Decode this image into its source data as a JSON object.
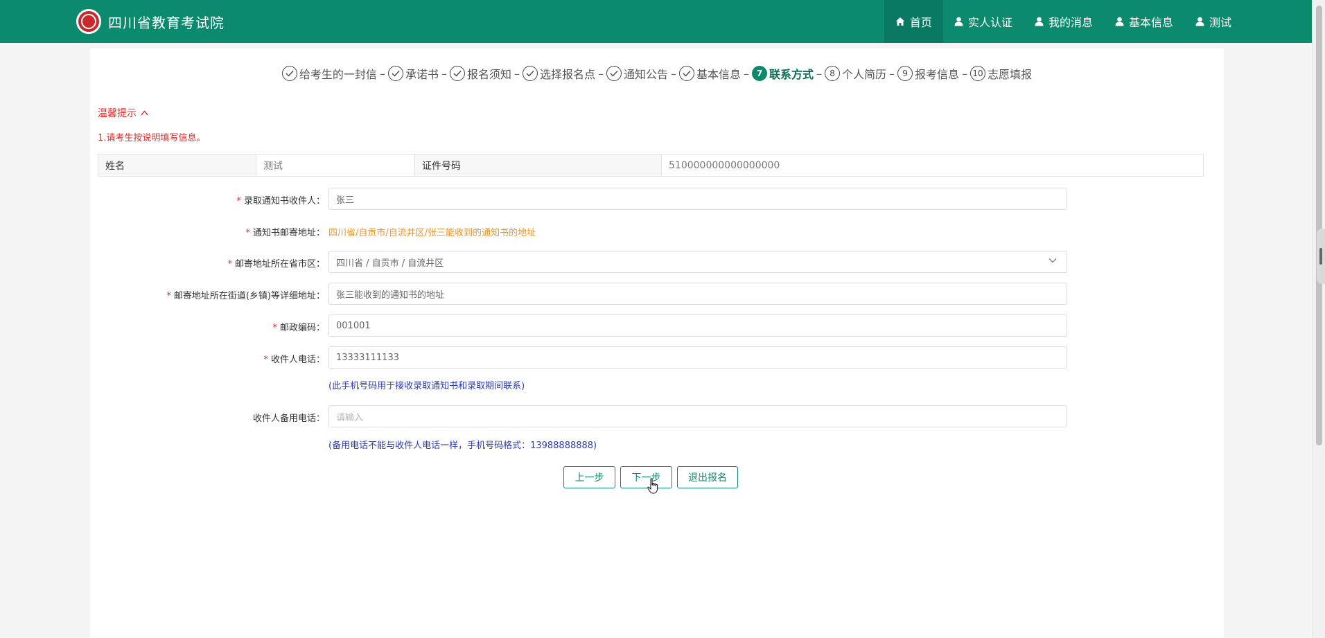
{
  "header": {
    "site_name": "四川省教育考试院",
    "nav": [
      {
        "label": "首页",
        "icon": "home-icon",
        "active": true
      },
      {
        "label": "实人认证",
        "icon": "user-icon"
      },
      {
        "label": "我的消息",
        "icon": "user-icon"
      },
      {
        "label": "基本信息",
        "icon": "user-icon"
      },
      {
        "label": "测试",
        "icon": "user-icon"
      }
    ]
  },
  "steps": [
    {
      "label": "给考生的一封信",
      "status": "done"
    },
    {
      "label": "承诺书",
      "status": "done"
    },
    {
      "label": "报名须知",
      "status": "done"
    },
    {
      "label": "选择报名点",
      "status": "done"
    },
    {
      "label": "通知公告",
      "status": "done"
    },
    {
      "label": "基本信息",
      "status": "done"
    },
    {
      "label": "联系方式",
      "number": "7",
      "status": "active"
    },
    {
      "label": "个人简历",
      "number": "8",
      "status": "todo"
    },
    {
      "label": "报考信息",
      "number": "9",
      "status": "todo"
    },
    {
      "label": "志愿填报",
      "number": "10",
      "status": "todo"
    }
  ],
  "step_separator": "–",
  "tips": {
    "title": "温馨提示",
    "text": "1.请考生按说明填写信息。"
  },
  "info": {
    "name_label": "姓名",
    "name_value": "测试",
    "id_label": "证件号码",
    "id_value": "510000000000000000"
  },
  "form": {
    "recipient": {
      "label": "录取通知书收件人：",
      "value": "张三"
    },
    "mail_address": {
      "label": "通知书邮寄地址：",
      "value": "四川省/自贡市/自流井区/张三能收到的通知书的地址"
    },
    "region": {
      "label": "邮寄地址所在省市区：",
      "value": "四川省 / 自贡市 / 自流井区"
    },
    "detail_address": {
      "label": "邮寄地址所在街道(乡镇)等详细地址：",
      "value": "张三能收到的通知书的地址"
    },
    "postcode": {
      "label": "邮政编码：",
      "value": "001001"
    },
    "phone": {
      "label": "收件人电话：",
      "value": "13333111133",
      "hint": "(此手机号码用于接收录取通知书和录取期间联系)"
    },
    "backup_phone": {
      "label": "收件人备用电话：",
      "placeholder": "请输入",
      "hint": "(备用电话不能与收件人电话一样，手机号码格式：13988888888)"
    }
  },
  "buttons": {
    "prev": "上一步",
    "next": "下一步",
    "quit": "退出报名"
  },
  "colors": {
    "primary": "#0b8a6e",
    "required": "#e0302d",
    "orange": "#f29227",
    "hint_blue": "#2c3bb8"
  }
}
